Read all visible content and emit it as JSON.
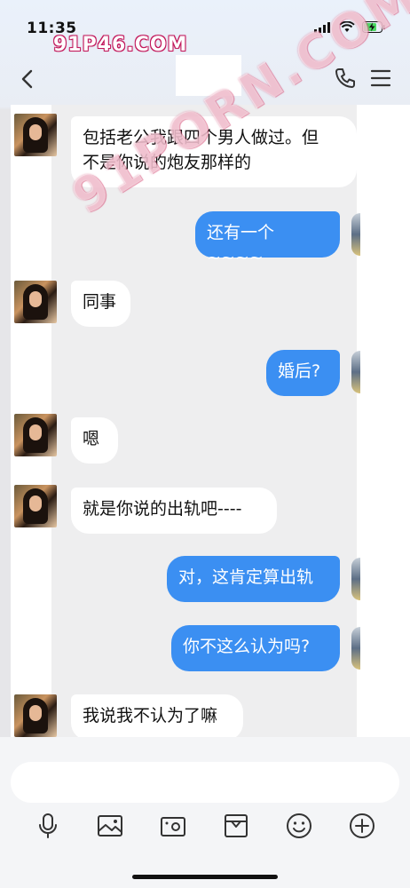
{
  "status": {
    "time": "11:35"
  },
  "watermark": {
    "top": "91P46.COM",
    "diagonal": "91PORN.COM"
  },
  "nav": {
    "back_icon": "chevron-left-icon",
    "call_icon": "phone-icon",
    "menu_icon": "hamburger-icon"
  },
  "messages": [
    {
      "side": "in",
      "text": "包括老公我跟四个男人做过。但\n不是你说的炮友那样的"
    },
    {
      "side": "out",
      "text": "还有一个 ~~~~"
    },
    {
      "side": "in",
      "text": "同事"
    },
    {
      "side": "out",
      "text": "婚后?"
    },
    {
      "side": "in",
      "text": "嗯"
    },
    {
      "side": "in",
      "text": "就是你说的出轨吧----"
    },
    {
      "side": "out",
      "text": "对，这肯定算出轨"
    },
    {
      "side": "out",
      "text": "你不这么认为吗?"
    },
    {
      "side": "in",
      "text": "我说我不认为了嘛"
    }
  ],
  "composer": {
    "placeholder": ""
  },
  "toolbar": {
    "icons": [
      "microphone-icon",
      "image-icon",
      "camera-icon",
      "gift-icon",
      "emoji-icon",
      "plus-icon"
    ]
  },
  "colors": {
    "outgoing": "#3b8ff2",
    "incoming": "#ffffff"
  }
}
